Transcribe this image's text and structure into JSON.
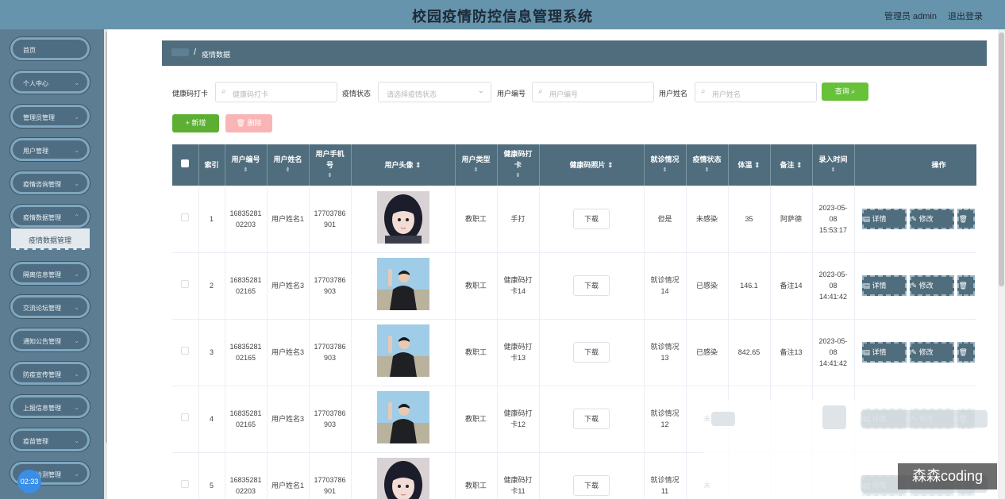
{
  "header": {
    "title": "校园疫情防控信息管理系统",
    "admin": "管理员 admin",
    "logout": "退出登录"
  },
  "sidebar": {
    "items": [
      {
        "label": "首页"
      },
      {
        "label": "个人中心"
      },
      {
        "label": "管理员管理"
      },
      {
        "label": "用户管理"
      },
      {
        "label": "疫情咨询管理"
      },
      {
        "label": "疫情数据管理"
      },
      {
        "label": "隔离信息管理"
      },
      {
        "label": "交流论坛管理"
      },
      {
        "label": "通知公告管理"
      },
      {
        "label": "防疫宣传管理"
      },
      {
        "label": "上报信息管理"
      },
      {
        "label": "疫苗管理"
      },
      {
        "label": "核酸检测管理"
      }
    ],
    "active_sub": "疫情数据管理",
    "clock": "02:33"
  },
  "breadcrumb": {
    "current": "疫情数据"
  },
  "search": {
    "f1_label": "健康码打卡",
    "f1_placeholder": "健康码打卡",
    "f2_label": "疫情状态",
    "f2_placeholder": "请选择疫情状态",
    "f3_label": "用户编号",
    "f3_placeholder": "用户编号",
    "f4_label": "用户姓名",
    "f4_placeholder": "用户姓名",
    "query": "查询"
  },
  "actions": {
    "add": "+ 新增",
    "delete": "删除"
  },
  "table": {
    "headers": {
      "index": "索引",
      "user_no": "用户编号",
      "user_name": "用户姓名",
      "phone": "用户手机号",
      "avatar": "用户头像",
      "user_type": "用户类型",
      "health_code": "健康码打卡",
      "code_photo": "健康码照片",
      "visit": "就诊情况",
      "status": "疫情状态",
      "temp": "体温",
      "note": "备注",
      "time": "录入时间",
      "op": "操作"
    },
    "rows": [
      {
        "index": "1",
        "user_no": "1683528102203",
        "user_name": "用户姓名1",
        "phone": "17703786901",
        "avatar": "girl",
        "user_type": "教职工",
        "health_code": "手打",
        "download": "下载",
        "visit": "但是",
        "status": "未感染",
        "temp": "35",
        "note": "阿萨德",
        "time": "2023-05-08 15:53:17"
      },
      {
        "index": "2",
        "user_no": "1683528102165",
        "user_name": "用户姓名3",
        "phone": "17703786903",
        "avatar": "boy",
        "user_type": "教职工",
        "health_code": "健康码打卡14",
        "download": "下载",
        "visit": "就诊情况14",
        "status": "已感染",
        "temp": "146.1",
        "note": "备注14",
        "time": "2023-05-08 14:41:42"
      },
      {
        "index": "3",
        "user_no": "1683528102165",
        "user_name": "用户姓名3",
        "phone": "17703786903",
        "avatar": "boy",
        "user_type": "教职工",
        "health_code": "健康码打卡13",
        "download": "下载",
        "visit": "就诊情况13",
        "status": "已感染",
        "temp": "842.65",
        "note": "备注13",
        "time": "2023-05-08 14:41:42"
      },
      {
        "index": "4",
        "user_no": "1683528102165",
        "user_name": "用户姓名3",
        "phone": "17703786903",
        "avatar": "boy",
        "user_type": "教职工",
        "health_code": "健康码打卡12",
        "download": "下载",
        "visit": "就诊情况12",
        "status": "未",
        "temp": "",
        "note": "",
        "time": ""
      },
      {
        "index": "5",
        "user_no": "1683528102203",
        "user_name": "用户姓名1",
        "phone": "17703786901",
        "avatar": "girl",
        "user_type": "教职工",
        "health_code": "健康码打卡11",
        "download": "下载",
        "visit": "就诊情况11",
        "status": "未",
        "temp": "",
        "note": "",
        "time": ""
      }
    ],
    "op_detail": "详情",
    "op_edit": "修改"
  },
  "watermark": "森森coding",
  "colors": {
    "header": "#6794ad",
    "sidebar": "#5c7d92",
    "table_header": "#4f6d7d",
    "query": "#67c23a",
    "delete": "#f9b5b5"
  }
}
